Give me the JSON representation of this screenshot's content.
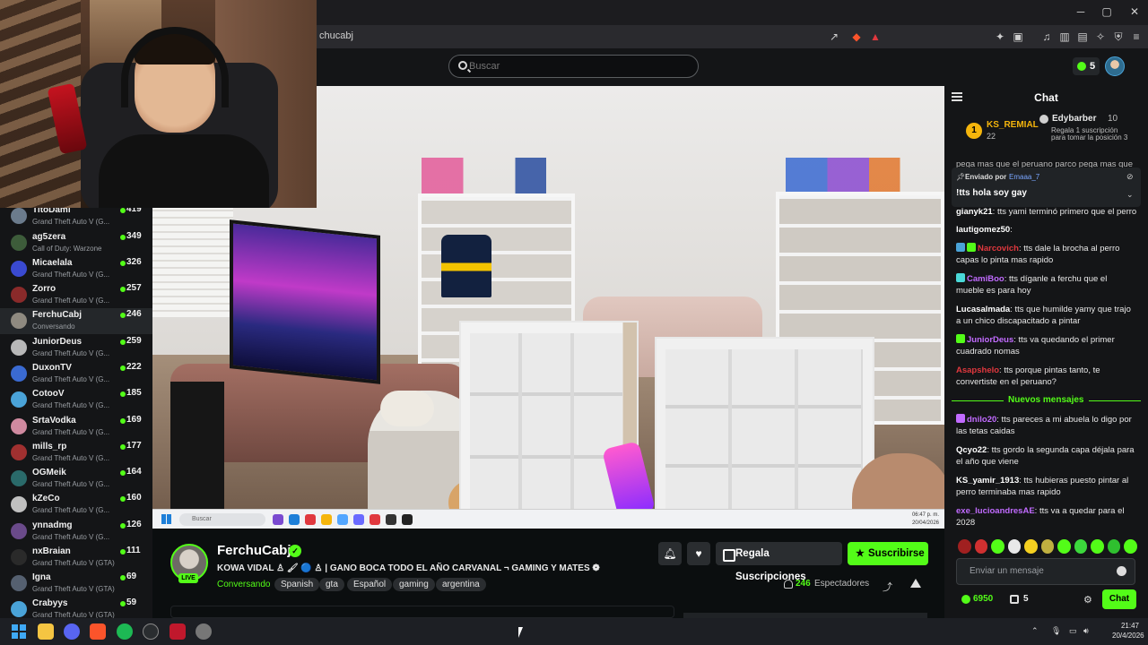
{
  "browser": {
    "url": "kick.com/ferchucabj",
    "url_visible": "chucabj"
  },
  "header": {
    "search_placeholder": "Buscar",
    "notification_count": "5"
  },
  "sidebar": {
    "channels": [
      {
        "name": "TitoDami",
        "game": "Grand Theft Auto V (G...",
        "viewers": "419",
        "color": "#6b7b8c"
      },
      {
        "name": "ag5zera",
        "game": "Call of Duty: Warzone",
        "viewers": "349",
        "color": "#3d5c3a"
      },
      {
        "name": "Micaelala",
        "game": "Grand Theft Auto V (G...",
        "viewers": "326",
        "color": "#3a4ad1"
      },
      {
        "name": "Zorro",
        "game": "Grand Theft Auto V (G...",
        "viewers": "257",
        "color": "#8a2a2a"
      },
      {
        "name": "FerchuCabj",
        "game": "Conversando",
        "viewers": "246",
        "color": "#8f8a80"
      },
      {
        "name": "JuniorDeus",
        "game": "Grand Theft Auto V (G...",
        "viewers": "259",
        "color": "#b8b8b8"
      },
      {
        "name": "DuxonTV",
        "game": "Grand Theft Auto V (G...",
        "viewers": "222",
        "color": "#3a6ad1"
      },
      {
        "name": "CotooV",
        "game": "Grand Theft Auto V (G...",
        "viewers": "185",
        "color": "#4aa3d8"
      },
      {
        "name": "SrtaVodka",
        "game": "Grand Theft Auto V (G...",
        "viewers": "169",
        "color": "#d08aa0"
      },
      {
        "name": "mills_rp",
        "game": "Grand Theft Auto V (G...",
        "viewers": "177",
        "color": "#a03030"
      },
      {
        "name": "OGMeik",
        "game": "Grand Theft Auto V (G...",
        "viewers": "164",
        "color": "#2a6a6a"
      },
      {
        "name": "kZeCo",
        "game": "Grand Theft Auto V (G...",
        "viewers": "160",
        "color": "#c0c0c0"
      },
      {
        "name": "ynnadmg",
        "game": "Grand Theft Auto V (G...",
        "viewers": "126",
        "color": "#6a4a8a"
      },
      {
        "name": "nxBraian",
        "game": "Grand Theft Auto V (GTA)",
        "viewers": "111",
        "color": "#2a2a2a"
      },
      {
        "name": "Igna",
        "game": "Grand Theft Auto V (GTA)",
        "viewers": "69",
        "color": "#556070"
      },
      {
        "name": "Crabyys",
        "game": "Grand Theft Auto V (GTA)",
        "viewers": "59",
        "color": "#4aa3d8"
      }
    ]
  },
  "video": {
    "inner_search": "Buscar",
    "inner_time": "06:47 p. m.",
    "inner_date": "20/04/2026"
  },
  "stream": {
    "streamer": "FerchuCabj",
    "live_label": "LIVE",
    "title": "KOWA VIDAL ♙ 🖌 🔵 ♙ | GANO BOCA TODO EL AÑO CARVANAL ¬ GAMING Y MATES ❁",
    "category": "Conversando",
    "tags": [
      "Spanish",
      "gta",
      "Español",
      "gaming",
      "argentina"
    ],
    "gift_label": "Regala Suscripciones",
    "subscribe_label": "Suscribirse",
    "viewer_count": "246",
    "viewers_label": "Espectadores"
  },
  "chat": {
    "title": "Chat",
    "leaderboard": [
      {
        "rank": "1",
        "name": "KS_REMIAL",
        "count": "22"
      },
      {
        "name": "Edybarber",
        "count": "10",
        "sub": "Regala 1 suscripción para tomar la posición 3"
      }
    ],
    "cut_line": "pega mas que el peruano parco pega mas que",
    "pinned": {
      "by_label": "Enviado por",
      "user": "Emaaa_7",
      "message": "!tts hola soy gay"
    },
    "messages": [
      {
        "user": "gianyk21",
        "color": "#ffffff",
        "text": "tts yami terminó primero que el perro",
        "badges": []
      },
      {
        "user": "lautigomez50",
        "color": "#ffffff",
        "text": "",
        "badges": []
      },
      {
        "user": "Narcovich",
        "color": "#e0383e",
        "text": "tts dale la brocha al perro capas lo pinta mas rapido",
        "badges": [
          "#4aa3d8",
          "#53fc18"
        ]
      },
      {
        "user": "CamiBoo",
        "color": "#c16bff",
        "text": "tts díganle a ferchu que el mueble es para hoy",
        "badges": [
          "#4ad8d8"
        ]
      },
      {
        "user": "Lucasalmada",
        "color": "#ffffff",
        "text": "tts que humilde yamy que trajo a un chico discapacitado a pintar",
        "badges": []
      },
      {
        "user": "JuniorDeus",
        "color": "#c16bff",
        "text": "tts va quedando el primer cuadrado nomas",
        "badges": [
          "#53fc18"
        ]
      },
      {
        "user": "Asapshelo",
        "color": "#e0383e",
        "text": "tts porque pintas tanto, te convertiste en el peruano?",
        "badges": []
      },
      {
        "user": "dnilo20",
        "color": "#c16bff",
        "text": "tts pareces a mi abuela lo digo por las tetas caidas",
        "badges": [
          "#c16bff"
        ]
      },
      {
        "user": "Qcyo22",
        "color": "#ffffff",
        "text": "tts gordo la segunda capa déjala para el año que viene",
        "badges": []
      },
      {
        "user": "KS_yamir_1913",
        "color": "#ffffff",
        "text": "tts hubieras puesto pintar al perro terminaba mas rapido",
        "badges": []
      },
      {
        "user": "exe_lucioandresAE",
        "color": "#c16bff",
        "text": "tts va a quedar para el 2028",
        "badges": []
      }
    ],
    "new_messages_label": "Nuevos mensajes",
    "input_placeholder": "Enviar un mensaje",
    "points": "6950",
    "chests": "5",
    "send_label": "Chat"
  },
  "taskbar": {
    "time": "21:47",
    "date": "20/4/2026"
  }
}
